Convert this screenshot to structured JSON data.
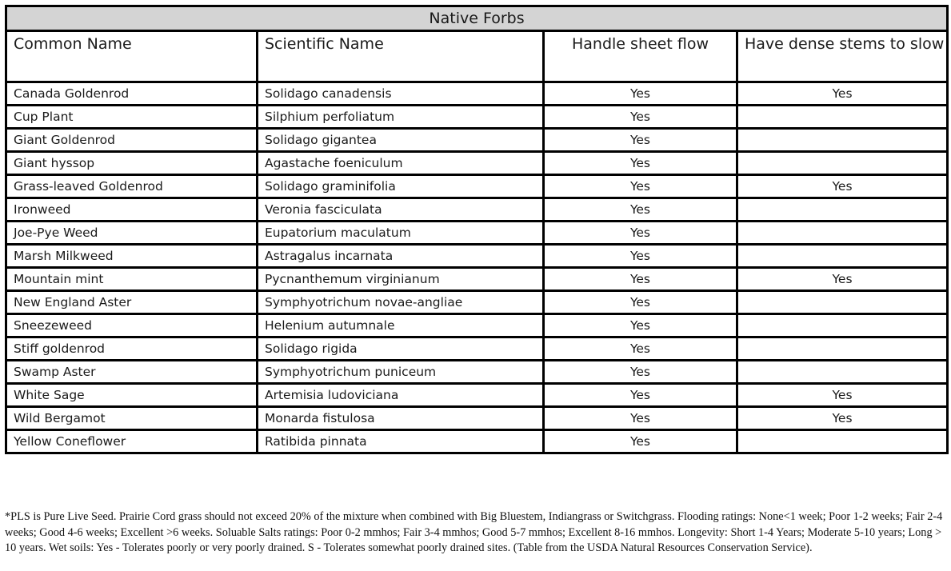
{
  "table": {
    "title": "Native Forbs",
    "headers": [
      "Common Name",
      "Scientific Name",
      "Handle sheet flow",
      "Have dense stems to slow water flow"
    ],
    "rows": [
      [
        "Canada Goldenrod",
        "Solidago canadensis",
        "Yes",
        "Yes"
      ],
      [
        "Cup Plant",
        "Silphium perfoliatum",
        "Yes",
        ""
      ],
      [
        "Giant Goldenrod",
        "Solidago gigantea",
        "Yes",
        ""
      ],
      [
        "Giant hyssop",
        "Agastache foeniculum",
        "Yes",
        ""
      ],
      [
        "Grass-leaved Goldenrod",
        "Solidago graminifolia",
        "Yes",
        "Yes"
      ],
      [
        "Ironweed",
        "Veronia fasciculata",
        "Yes",
        ""
      ],
      [
        "Joe-Pye Weed",
        "Eupatorium maculatum",
        "Yes",
        ""
      ],
      [
        "Marsh Milkweed",
        "Astragalus incarnata",
        "Yes",
        ""
      ],
      [
        "Mountain mint",
        "Pycnanthemum virginianum",
        "Yes",
        "Yes"
      ],
      [
        "New England Aster",
        "Symphyotrichum novae-angliae",
        "Yes",
        ""
      ],
      [
        "Sneezeweed",
        "Helenium autumnale",
        "Yes",
        ""
      ],
      [
        "Stiff goldenrod",
        "Solidago rigida",
        "Yes",
        ""
      ],
      [
        "Swamp Aster",
        "Symphyotrichum puniceum",
        "Yes",
        ""
      ],
      [
        "White Sage",
        "Artemisia ludoviciana",
        "Yes",
        "Yes"
      ],
      [
        "Wild Bergamot",
        "Monarda fistulosa",
        "Yes",
        "Yes"
      ],
      [
        "Yellow Coneflower",
        "Ratibida pinnata",
        "Yes",
        ""
      ]
    ]
  },
  "footnote": "*PLS is Pure Live Seed. Prairie Cord grass should not exceed 20% of the mixture when combined with Big Bluestem, Indiangrass or Switchgrass. Flooding ratings: None<1 week; Poor 1-2 weeks; Fair 2-4 weeks; Good 4-6 weeks; Excellent >6 weeks. Soluable Salts ratings: Poor 0-2 mmhos; Fair 3-4 mmhos; Good 5-7 mmhos; Excellent 8-16 mmhos. Longevity: Short 1-4 Years; Moderate 5-10 years; Long > 10 years. Wet soils: Yes - Tolerates poorly or very poorly drained. S - Tolerates somewhat poorly drained sites.  (Table from the USDA Natural Resources Conservation Service)."
}
